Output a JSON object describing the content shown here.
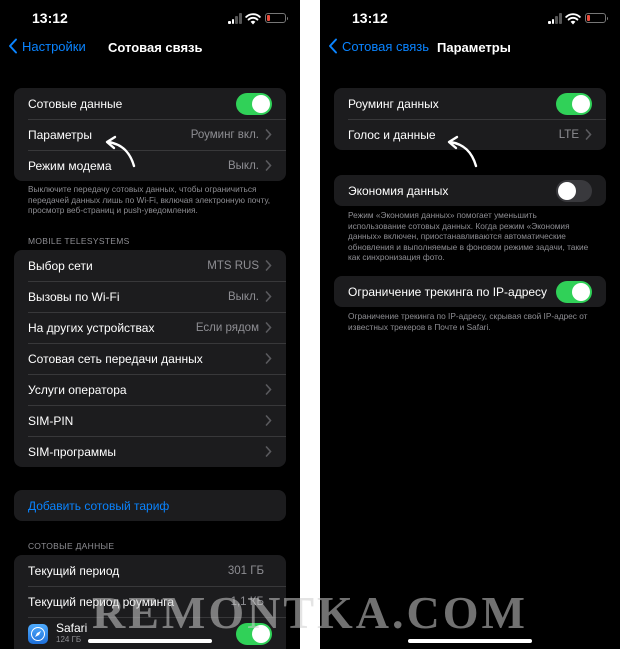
{
  "left": {
    "status": {
      "time": "13:12"
    },
    "nav": {
      "back_label": "Настройки",
      "title": "Сотовая связь"
    },
    "group1": {
      "cellular_data": {
        "label": "Сотовые данные",
        "enabled": true
      },
      "options": {
        "label": "Параметры",
        "value": "Роуминг вкл."
      },
      "hotspot": {
        "label": "Режим модема",
        "value": "Выкл."
      }
    },
    "note1": "Выключите передачу сотовых данных, чтобы ограничиться передачей данных лишь по Wi-Fi, включая электронную почту, просмотр веб-страниц и push-уведомления.",
    "carrier_header": "MOBILE TELESYSTEMS",
    "carrier_group": [
      {
        "label": "Выбор сети",
        "value": "MTS RUS"
      },
      {
        "label": "Вызовы по Wi-Fi",
        "value": "Выкл."
      },
      {
        "label": "На других устройствах",
        "value": "Если рядом"
      },
      {
        "label": "Сотовая сеть передачи данных",
        "value": ""
      },
      {
        "label": "Услуги оператора",
        "value": ""
      },
      {
        "label": "SIM-PIN",
        "value": ""
      },
      {
        "label": "SIM-программы",
        "value": ""
      }
    ],
    "add_plan": "Добавить сотовый тариф",
    "data_header": "СОТОВЫЕ ДАННЫЕ",
    "usage": {
      "current_period": {
        "label": "Текущий период",
        "value": "301 ГБ"
      },
      "roaming_period": {
        "label": "Текущий период роуминга",
        "value": "1,1 КБ"
      },
      "safari": {
        "name": "Safari",
        "size": "124 ГБ",
        "enabled": true
      }
    }
  },
  "right": {
    "status": {
      "time": "13:12"
    },
    "nav": {
      "back_label": "Сотовая связь",
      "title": "Параметры"
    },
    "group1": {
      "roaming": {
        "label": "Роуминг данных",
        "enabled": true
      },
      "voice_data": {
        "label": "Голос и данные",
        "value": "LTE"
      }
    },
    "low_data": {
      "label": "Экономия данных",
      "enabled": false
    },
    "note_low_data": "Режим «Экономия данных» помогает уменьшить использование сотовых данных. Когда режим «Экономия данных» включен, приостанавливаются автоматические обновления и выполняемые в фоновом режиме задачи, такие как синхронизация фото.",
    "ip_tracking": {
      "label": "Ограничение трекинга по IP-адресу",
      "enabled": true
    },
    "note_ip": "Ограничение трекинга по IP-адресу, скрывая свой IP-адрес от известных трекеров в Почте и Safari."
  },
  "watermark": "REMONTKA.COM",
  "colors": {
    "accent": "#0a84ff",
    "toggle_on": "#30d158",
    "cell": "#1c1c1e"
  }
}
